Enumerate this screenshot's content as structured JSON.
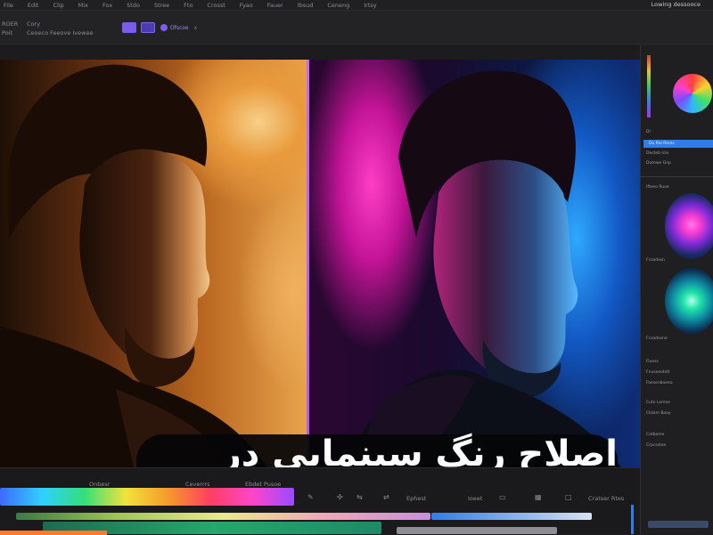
{
  "menubar": {
    "items": [
      "File",
      "Edit",
      "Clip",
      "Mix",
      "Fox",
      "Stdo",
      "Stree",
      "Fto",
      "Crosst",
      "Fyao",
      "Fauer",
      "Ibsud",
      "Ceneng",
      "Irtsy"
    ],
    "workspace_label": "Lowing dessooce"
  },
  "toolbar": {
    "col1_line1": "ROER",
    "col1_line2": "Poit",
    "col2_line1": "Cory",
    "col2_line2": "Ceoeco Feeove Ivewee",
    "fx_chip_label": "Ofscoe",
    "fx_chip_close": "x"
  },
  "viewer": {
    "title": "اصلاح رنگ سینمایی در پریمیر"
  },
  "right_panel": {
    "labels": [
      "Dl",
      "Du Rio Rinns",
      "Desteb Iclo",
      "Dutewe Gnp",
      "Ifteeo Ruoe",
      "Fcsadosn",
      "Fcsadosne",
      "Fiuoss",
      "Fnuseeotstt",
      "Faesenboeeo",
      "Cuto Lomoe",
      "Ctdom Baoy",
      "Cotbome",
      "Crpcsstoe"
    ],
    "colors": {
      "accent_blue": "#2f7de8",
      "wheel_pink": "#ff4fd8",
      "wheel_green": "#21e3a8"
    }
  },
  "timeline": {
    "label_left": "Onbesr",
    "label_mid": "Ceverrrs",
    "label_tl": "Ebdet Pusoe",
    "epithet": "Ephest",
    "ioeet": "Ioeet",
    "rulers": "Cratser Rtes",
    "tools": [
      "pen-icon",
      "marker-icon",
      "ripple-icon",
      "slip-icon",
      "folder-icon",
      "grid-icon",
      "text-icon"
    ]
  }
}
